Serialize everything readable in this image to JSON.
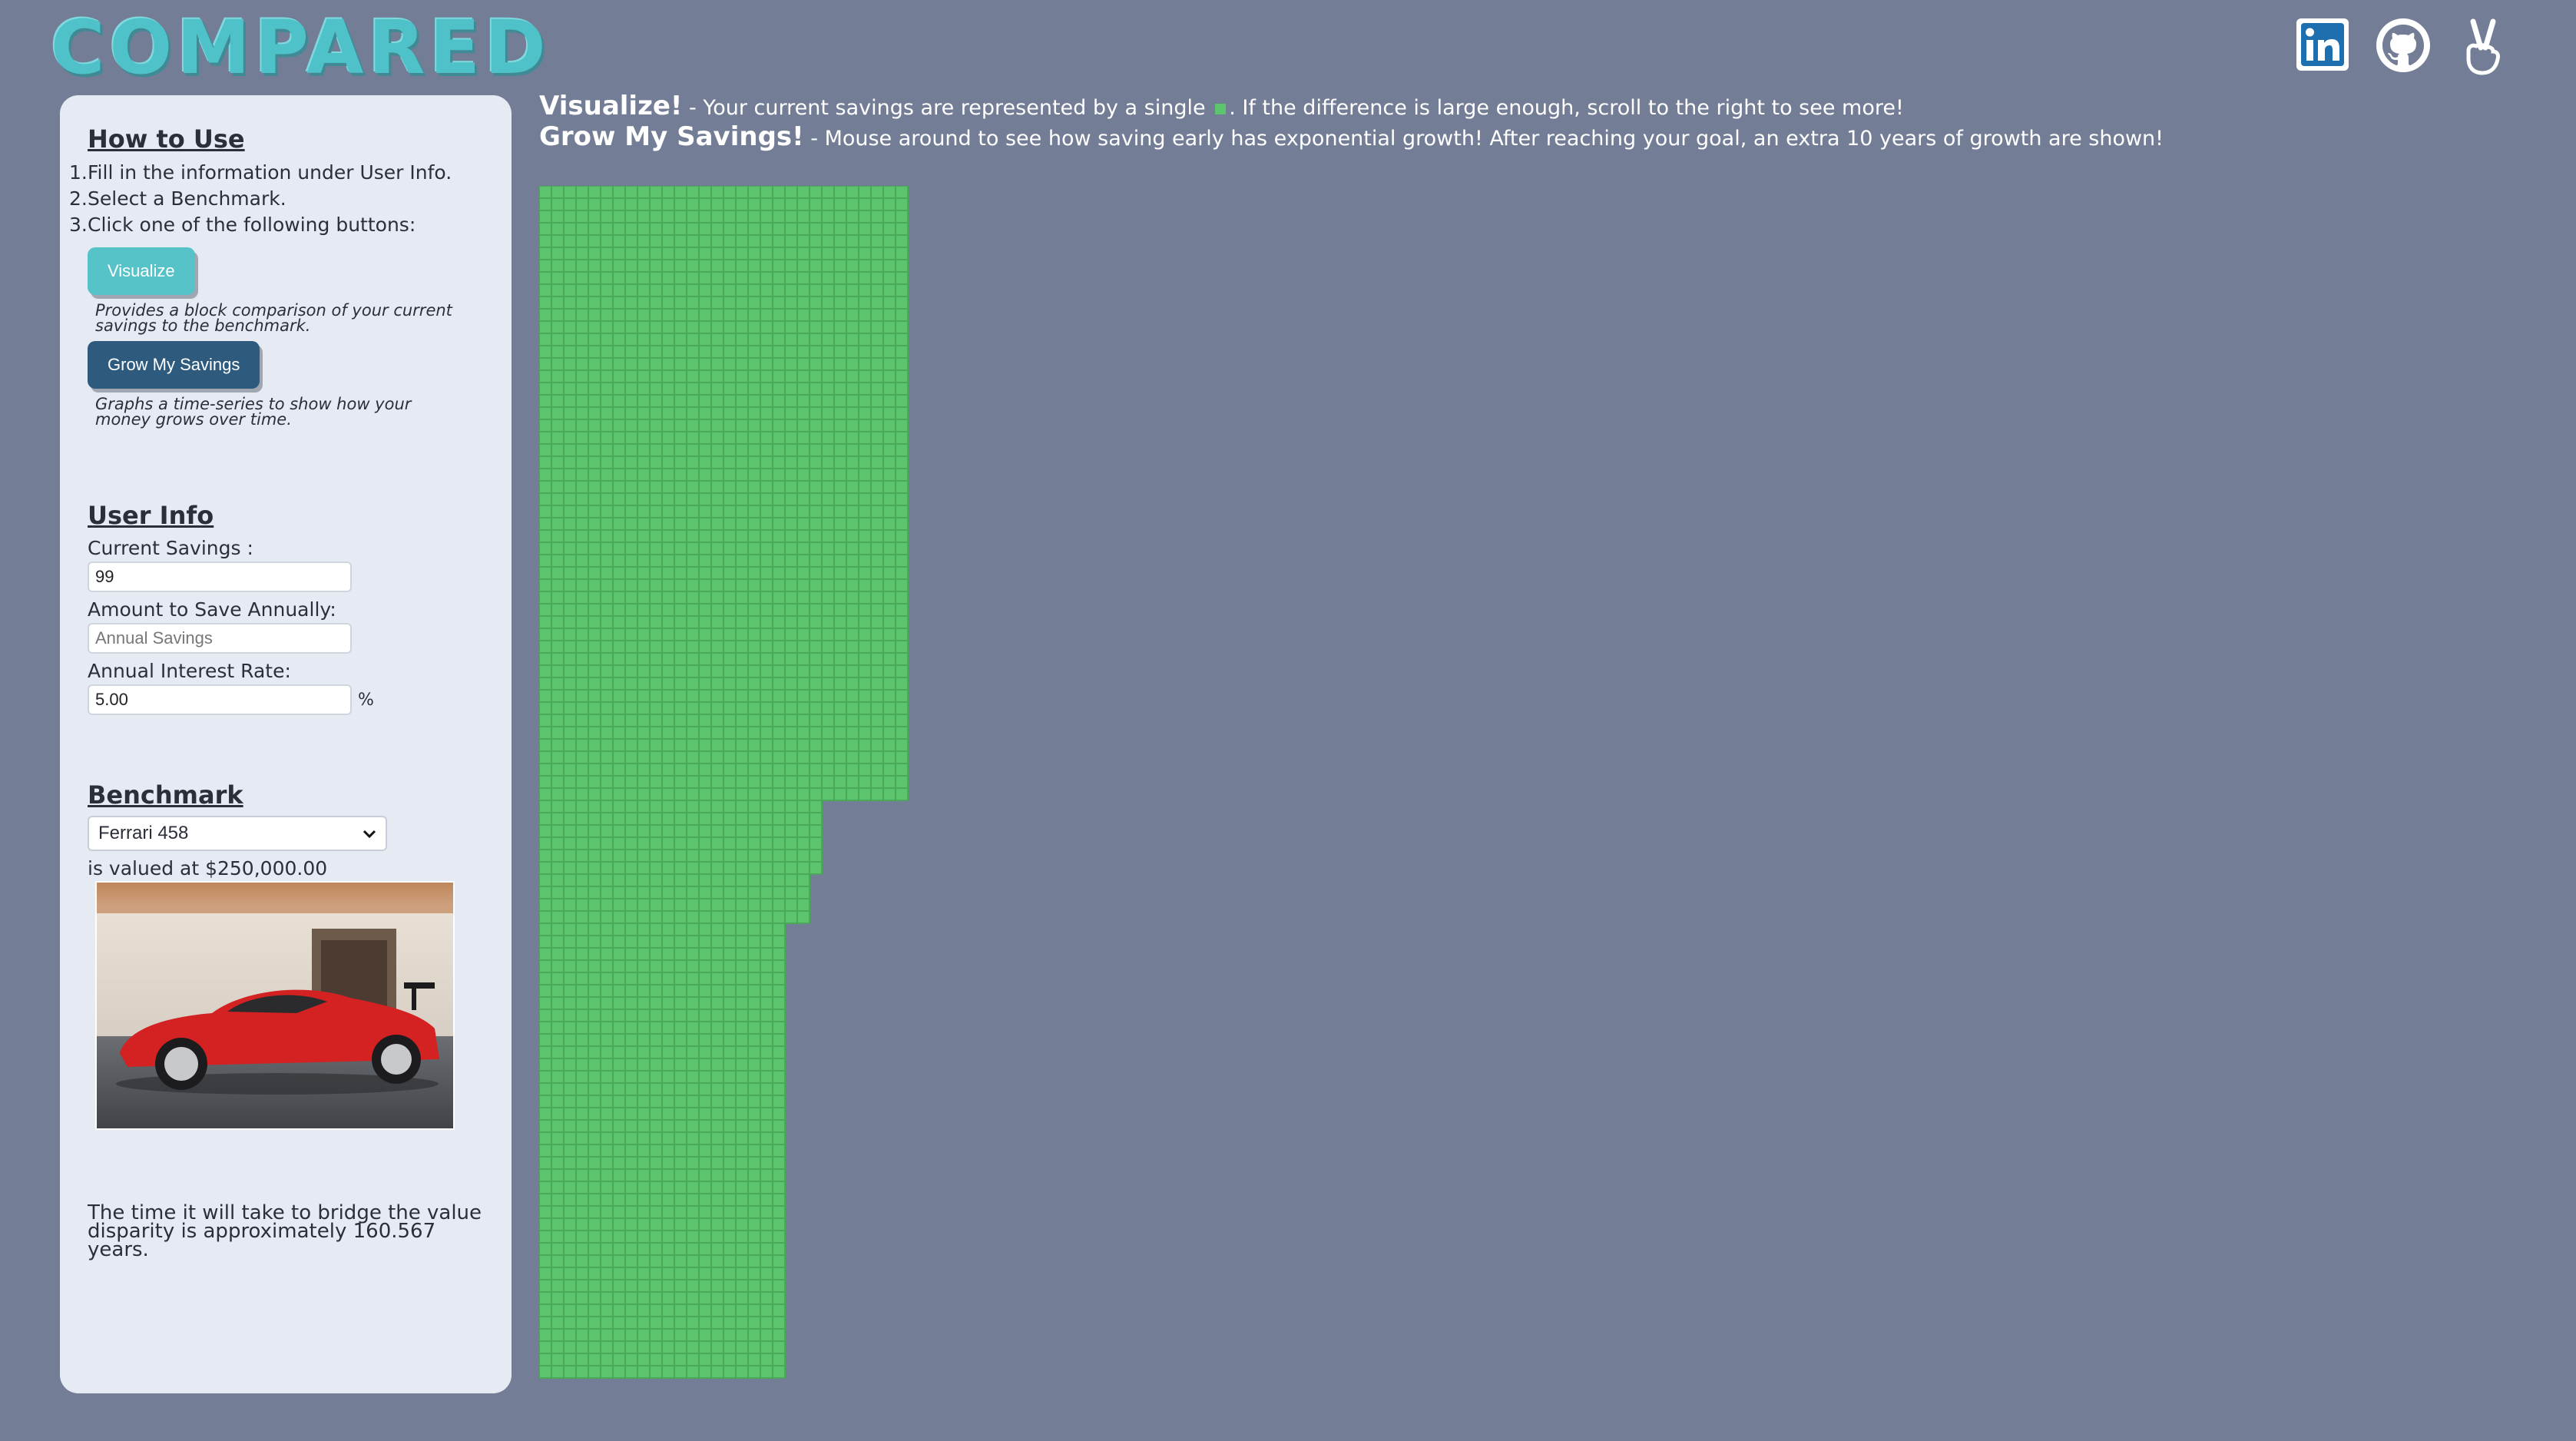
{
  "header": {
    "logo_text": "COMPARED",
    "social": [
      {
        "name": "linkedin-icon"
      },
      {
        "name": "github-icon"
      },
      {
        "name": "peace-icon"
      }
    ]
  },
  "sidebar": {
    "how_to_title": "How to Use",
    "steps": [
      {
        "num": "1.",
        "text": "Fill in the information under User Info."
      },
      {
        "num": "2.",
        "text": "Select a Benchmark."
      },
      {
        "num": "3.",
        "text": "Click one of the following buttons:"
      }
    ],
    "visualize_label": "Visualize",
    "visualize_hint": "Provides a block comparison of your current savings to the benchmark.",
    "grow_label": "Grow My Savings",
    "grow_hint": "Graphs a time-series to show how your money grows over time.",
    "user_info_title": "User Info",
    "current_savings_label": "Current Savings :",
    "current_savings_value": "99",
    "annual_save_label": "Amount to Save Annually:",
    "annual_save_placeholder": "Annual Savings",
    "interest_label": "Annual Interest Rate:",
    "interest_value": "5.00",
    "interest_unit": "%",
    "benchmark_title": "Benchmark",
    "benchmark_selected": "Ferrari 458",
    "benchmark_value_text": "is valued at $250,000.00",
    "result_text": "The time it will take to bridge the value disparity is approximately 160.567 years."
  },
  "main": {
    "visualize_heading": "Visualize!",
    "visualize_text_a": " - Your current savings are represented by a single ",
    "visualize_text_b": ". If the difference is large enough, scroll to the right to see more!",
    "grow_heading": "Grow My Savings!",
    "grow_text": " - Mouse around to see how saving early has exponential growth! After reaching your goal, an extra 10 years of growth are shown!"
  },
  "colors": {
    "background": "#737d96",
    "panel": "#e6ebf3",
    "block": "#5dc46e",
    "block_border": "#4aa85a",
    "visualize_button": "#56c3c8",
    "grow_button": "#2d5a7d"
  }
}
